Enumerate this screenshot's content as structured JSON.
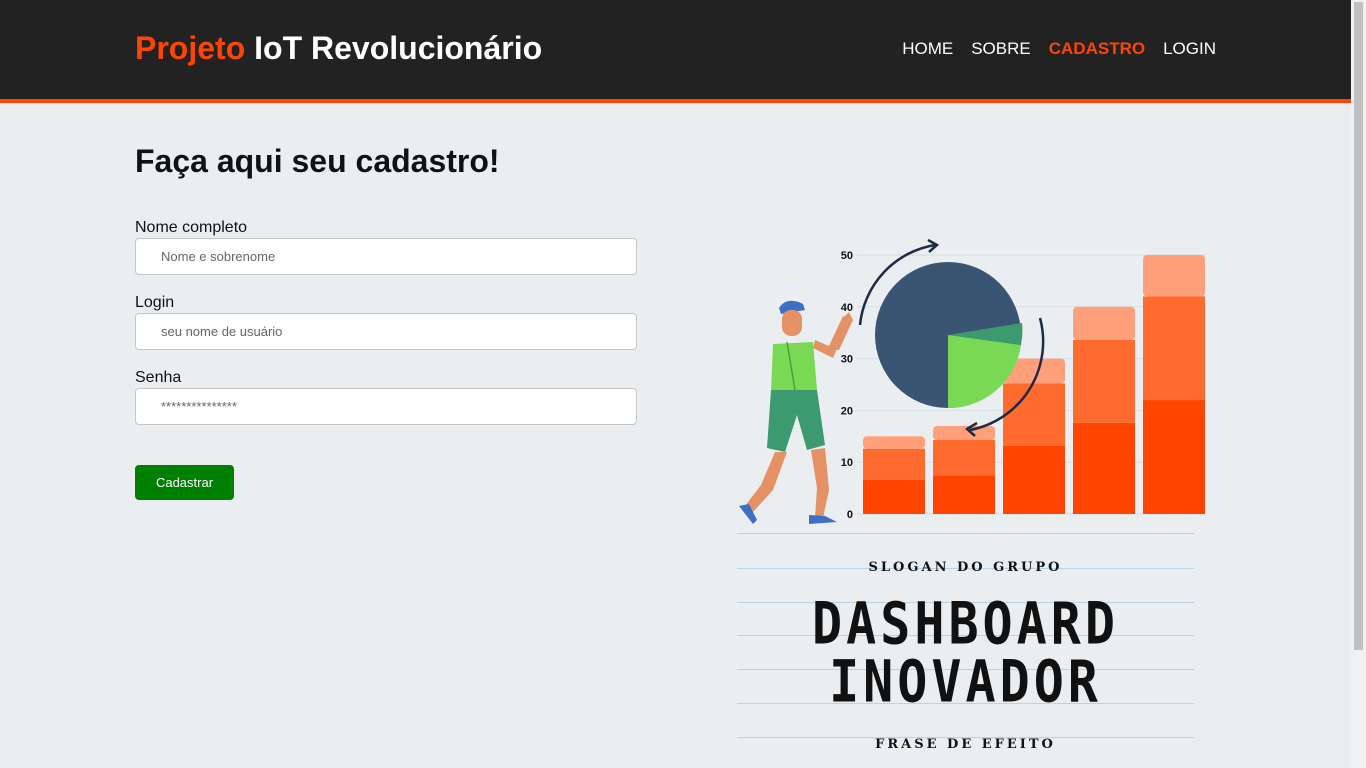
{
  "header": {
    "brand_accent": "Projeto",
    "brand_rest": "IoT Revolucionário",
    "nav": [
      {
        "label": "HOME"
      },
      {
        "label": "SOBRE"
      },
      {
        "label": "CADASTRO",
        "active": true
      },
      {
        "label": "LOGIN"
      }
    ]
  },
  "form": {
    "title": "Faça aqui seu cadastro!",
    "fields": [
      {
        "label": "Nome completo",
        "placeholder": "Nome e sobrenome"
      },
      {
        "label": "Login",
        "placeholder": "seu nome de usuário"
      },
      {
        "label": "Senha",
        "placeholder": "***************"
      }
    ],
    "submit_label": "Cadastrar"
  },
  "illustration": {
    "chart_data": {
      "type": "bar",
      "y_ticks": [
        "0",
        "10",
        "20",
        "30",
        "40",
        "50"
      ],
      "ylim": [
        0,
        50
      ],
      "values": [
        15,
        17,
        30,
        40,
        50
      ]
    }
  },
  "slogan": {
    "top": "SLOGAN DO GRUPO",
    "line1": "DASHBOARD",
    "line2": "INOVADOR",
    "bottom": "FRASE DE EFEITO"
  },
  "colors": {
    "accent": "#ff4500",
    "header_bg": "#222222",
    "button": "#008000",
    "page_bg": "#eaeef0"
  }
}
